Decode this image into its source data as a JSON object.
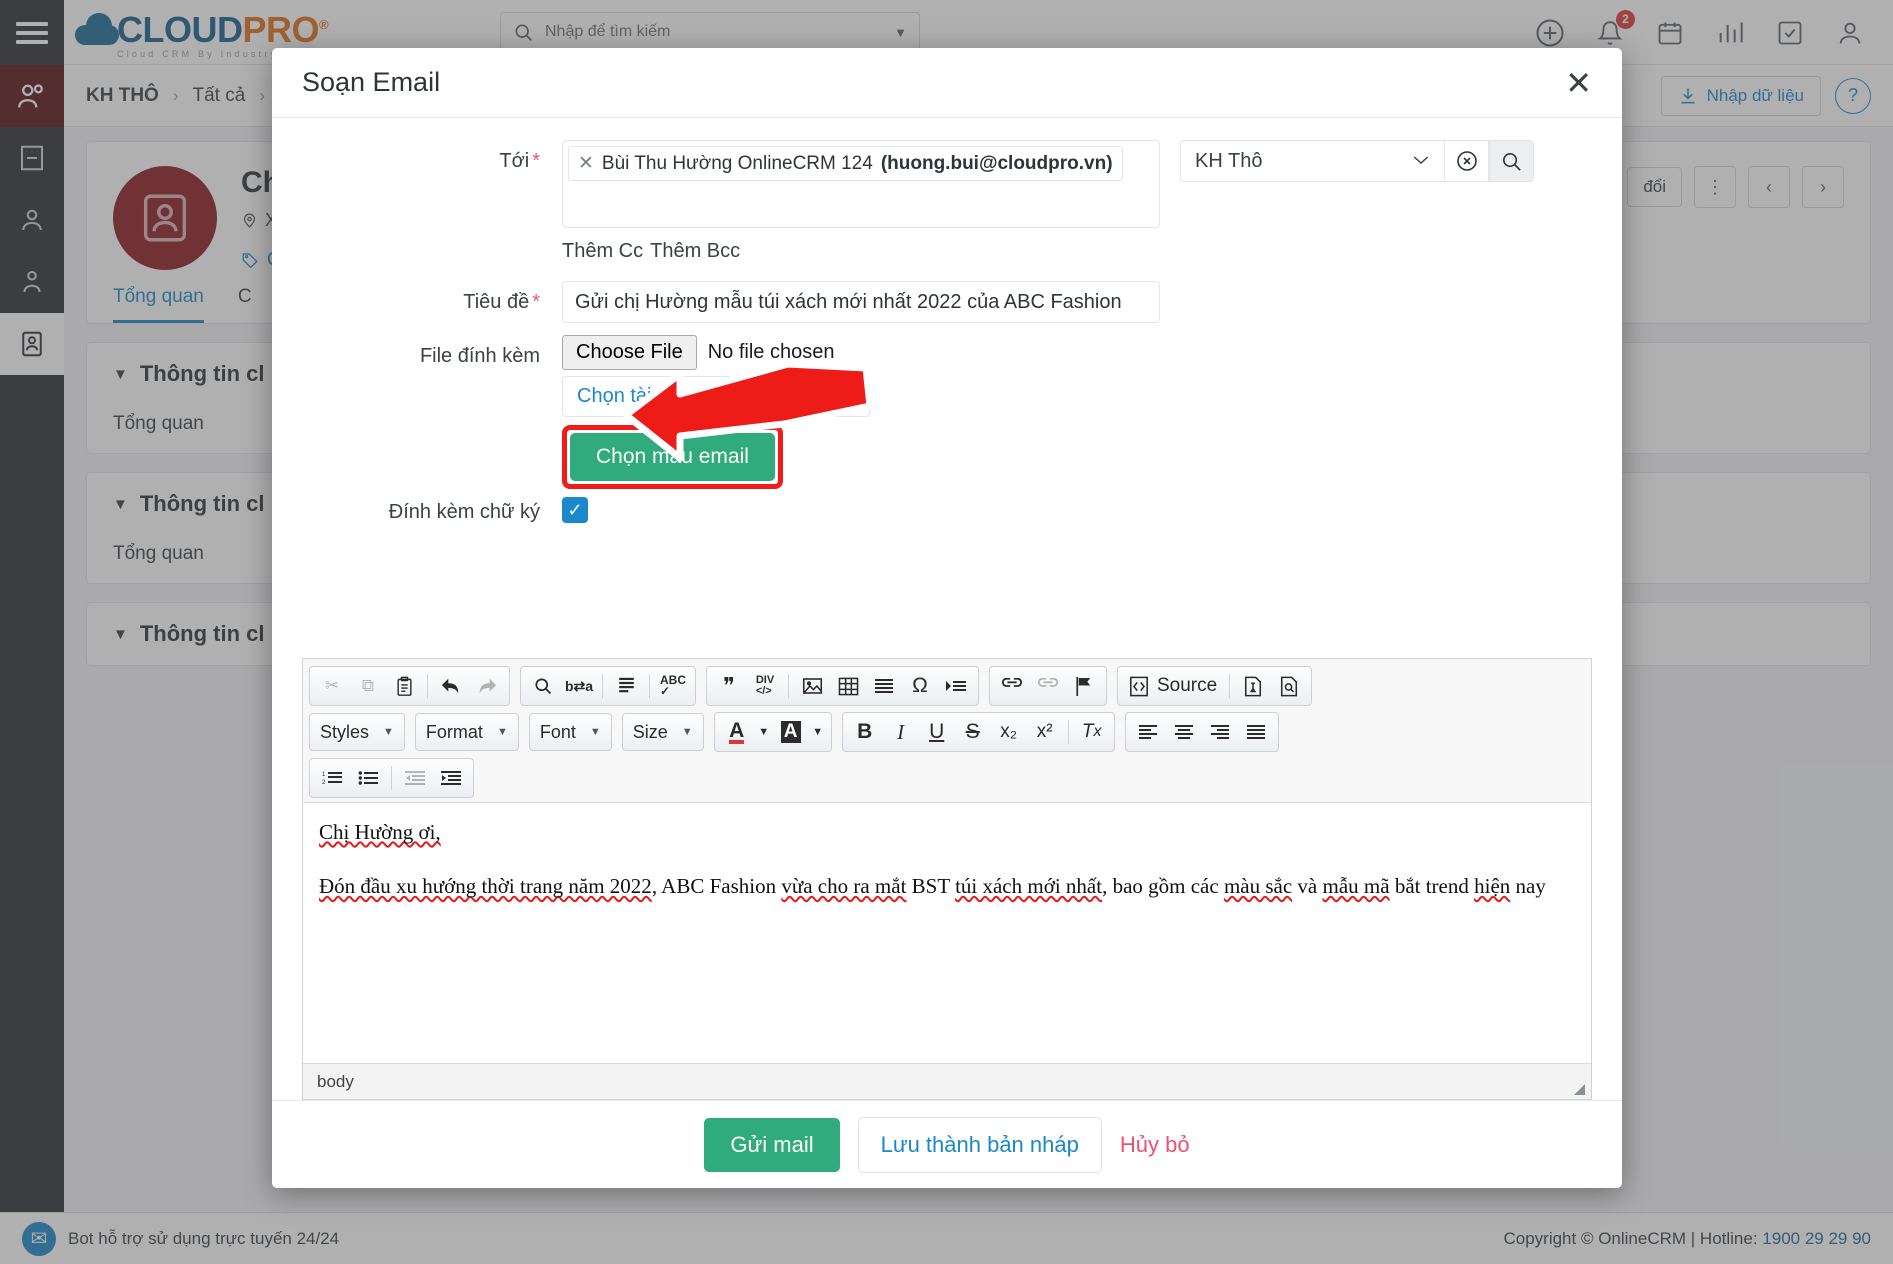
{
  "app": {
    "logo": {
      "main1": "CLOUD",
      "main2": "PRO",
      "reg": "®",
      "sub": "Cloud CRM By Industry"
    },
    "search_placeholder": "Nhập để tìm kiếm",
    "notification_count": "2",
    "breadcrumb": {
      "root": "KH THÔ",
      "sep": "›",
      "second": "Tất cả",
      "sep2": "›"
    },
    "import_button": "Nhập dữ liệu",
    "help": "?",
    "customer": {
      "name": "Ch",
      "location": "X",
      "tag": "Gán Tag",
      "pill": "đổi",
      "tabs": [
        "Tổng quan",
        "C"
      ],
      "sections": [
        {
          "title": "Thông tin cl",
          "sub": "Tổng quan"
        },
        {
          "title": "Thông tin cl",
          "sub": "Tổng quan"
        },
        {
          "title": "Thông tin cl",
          "sub": ""
        }
      ]
    },
    "footer": {
      "bot_text": "Bot hỗ trợ sử dụng trực tuyến 24/24",
      "copyright": "Copyright © OnlineCRM | Hotline: ",
      "hotline": "1900 29 29 90"
    }
  },
  "modal": {
    "title": "Soạn Email",
    "close": "✕",
    "fields": {
      "to_label": "Tới",
      "to_required": "*",
      "recipient_chip": {
        "remove": "✕",
        "name": "Bùi Thu Hường OnlineCRM 124 ",
        "email": "(huong.bui@cloudpro.vn)"
      },
      "group_select_value": "KH Thô",
      "group_chevron": "⌄",
      "clear_icon": "⊗",
      "search_icon": "search-icon",
      "add_cc": "Thêm Cc",
      "add_bcc": "Thêm Bcc",
      "subject_label": "Tiêu đề",
      "subject_required": "*",
      "subject_value": "Gửi chị Hường mẫu túi xách mới nhất 2022 của ABC Fashion",
      "attach_label": "File đính kèm",
      "choose_file_button": "Choose File",
      "no_file_chosen": "No file chosen",
      "crm_doc_button": "Chọn tài liệu có sẵn trong CRM",
      "template_button": "Chọn mẫu email",
      "signature_label": "Đính kèm chữ ký",
      "signature_checked": "✓"
    },
    "editor": {
      "toolbar_row1": [
        {
          "name": "cut-icon",
          "glyph": "✂",
          "dim": true
        },
        {
          "name": "copy-icon",
          "glyph": "⧉",
          "dim": true
        },
        {
          "name": "paste-icon",
          "glyph": "📋",
          "dim": false
        },
        {
          "name": "undo-icon",
          "glyph": "↰",
          "dim": false
        },
        {
          "name": "redo-icon",
          "glyph": "↱",
          "dim": true
        },
        {
          "name": "find-icon",
          "glyph": "🔍",
          "dim": false
        },
        {
          "name": "replace-icon",
          "glyph": "b⇄a",
          "dim": false
        },
        {
          "name": "select-all-icon",
          "glyph": "▤",
          "dim": false
        },
        {
          "name": "spellcheck-icon",
          "glyph": "ABC",
          "dim": false
        },
        {
          "name": "blockquote-icon",
          "glyph": "❞",
          "dim": false
        },
        {
          "name": "create-div-icon",
          "glyph": "DIV",
          "dim": false
        },
        {
          "name": "image-icon",
          "glyph": "🖼",
          "dim": false
        },
        {
          "name": "table-icon",
          "glyph": "▦",
          "dim": false
        },
        {
          "name": "horizontal-rule-icon",
          "glyph": "▤",
          "dim": false
        },
        {
          "name": "special-char-icon",
          "glyph": "Ω",
          "dim": false
        },
        {
          "name": "page-break-icon",
          "glyph": "▸▬",
          "dim": false
        },
        {
          "name": "link-icon",
          "glyph": "🔗",
          "dim": false
        },
        {
          "name": "unlink-icon",
          "glyph": "🔗",
          "dim": true
        },
        {
          "name": "anchor-icon",
          "glyph": "⚑",
          "dim": false
        }
      ],
      "source_label": "Source",
      "templates_icon": "templates-icon",
      "preview_icon": "preview-icon",
      "dropdowns": [
        "Styles",
        "Format",
        "Font",
        "Size"
      ],
      "text_color_icon": "A",
      "bg_color_icon": "A",
      "format_buttons": [
        {
          "name": "bold-button",
          "glyph": "B"
        },
        {
          "name": "italic-button",
          "glyph": "I"
        },
        {
          "name": "underline-button",
          "glyph": "U"
        },
        {
          "name": "strike-button",
          "glyph": "S"
        },
        {
          "name": "subscript-button",
          "glyph": "x₂"
        },
        {
          "name": "superscript-button",
          "glyph": "x²"
        },
        {
          "name": "remove-format-button",
          "glyph": "Tx"
        }
      ],
      "align_buttons": [
        {
          "name": "align-left-button",
          "glyph": "≡"
        },
        {
          "name": "align-center-button",
          "glyph": "≡"
        },
        {
          "name": "align-right-button",
          "glyph": "≡"
        },
        {
          "name": "align-justify-button",
          "glyph": "≡"
        }
      ],
      "list_buttons": [
        {
          "name": "numbered-list-button",
          "glyph": "1≡"
        },
        {
          "name": "bulleted-list-button",
          "glyph": "•≡"
        },
        {
          "name": "outdent-button",
          "glyph": "⇤"
        },
        {
          "name": "indent-button",
          "glyph": "⇥"
        }
      ],
      "body_line1": "Chị Hường ơi,",
      "body_line2_a": "Đón đầu xu hướng thời trang năm 2022",
      "body_line2_b": ", ABC Fashion ",
      "body_line2_c": "vừa cho ra mắt",
      "body_line2_d": " BST ",
      "body_line2_e": "túi xách mới nhất",
      "body_line2_f": ", bao gồm các ",
      "body_line2_g": "màu sắc",
      "body_line2_h": " và ",
      "body_line2_i": "mẫu mã",
      "body_line2_j": " bắt trend ",
      "body_line2_k": "hiện",
      "body_line2_l": " nay",
      "status_element": "body"
    },
    "footer": {
      "send": "Gửi mail",
      "draft": "Lưu thành bản nháp",
      "cancel": "Hủy bỏ"
    }
  },
  "colors": {
    "green": "#30ab7d",
    "blue": "#1b88c9",
    "red_highlight": "#ef1c18",
    "pink": "#ef5072"
  }
}
